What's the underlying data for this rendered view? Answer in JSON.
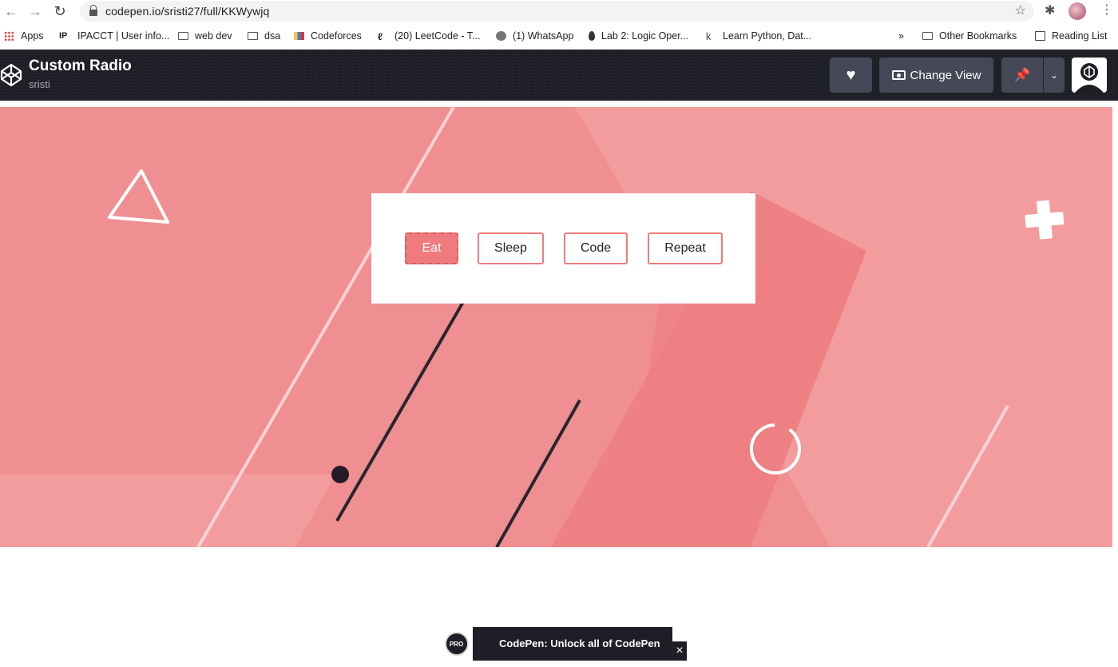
{
  "browser": {
    "url": "codepen.io/sristi27/full/KKWywjq",
    "bookmarks": [
      "Apps",
      "IPACCT | User info...",
      "web dev",
      "dsa",
      "Codeforces",
      "(20) LeetCode - T...",
      "(1) WhatsApp",
      "Lab 2: Logic Oper...",
      "Learn Python, Dat...",
      "»",
      "Other Bookmarks",
      "Reading List"
    ]
  },
  "codepen": {
    "title": "Custom Radio",
    "author": "sristi",
    "change_view_label": "Change View"
  },
  "pen": {
    "options": [
      "Eat",
      "Sleep",
      "Code",
      "Repeat"
    ],
    "selected": "Eat",
    "colors": {
      "background": "#f08f91",
      "accent": "#ef7b7e",
      "card": "#ffffff"
    }
  },
  "banner": {
    "badge": "PRO",
    "text": "CodePen: Unlock all of CodePen",
    "close": "×"
  }
}
